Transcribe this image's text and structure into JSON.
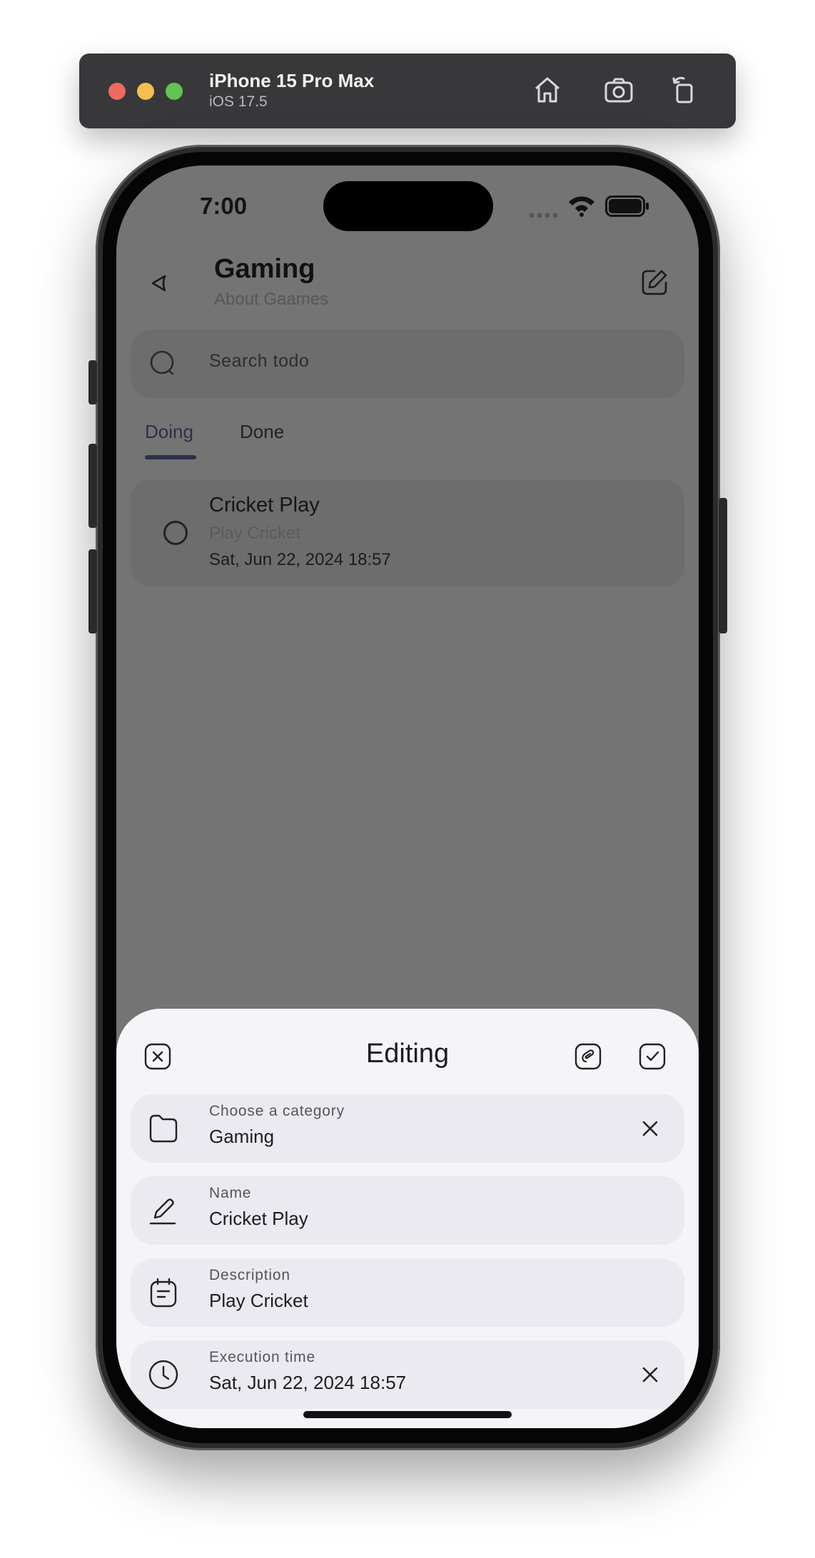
{
  "simulator": {
    "device_name": "iPhone 15 Pro Max",
    "os_version": "iOS 17.5",
    "buttons": [
      "home-icon",
      "screenshot-icon",
      "rotate-icon"
    ]
  },
  "status_bar": {
    "time": "7:00"
  },
  "header": {
    "title": "Gaming",
    "subtitle": "About Gaames"
  },
  "search": {
    "placeholder": "Search todo"
  },
  "tabs": [
    {
      "label": "Doing",
      "active": true
    },
    {
      "label": "Done",
      "active": false
    }
  ],
  "tasks": [
    {
      "name": "Cricket Play",
      "description": "Play Cricket",
      "time": "Sat, Jun 22, 2024 18:57",
      "done": false
    }
  ],
  "sheet": {
    "title": "Editing",
    "fields": [
      {
        "label": "Choose a category",
        "value": "Gaming",
        "icon": "folder-icon",
        "clearable": true
      },
      {
        "label": "Name",
        "value": "Cricket Play",
        "icon": "pencil-icon",
        "clearable": false
      },
      {
        "label": "Description",
        "value": "Play Cricket",
        "icon": "note-icon",
        "clearable": false
      },
      {
        "label": "Execution time",
        "value": "Sat, Jun 22, 2024 18:57",
        "icon": "clock-icon",
        "clearable": true
      }
    ]
  },
  "colors": {
    "active_tab": "#2b3148",
    "overlay": "#747474",
    "sheet_bg": "#f5f5f9",
    "field_bg": "#eaeaf0"
  }
}
